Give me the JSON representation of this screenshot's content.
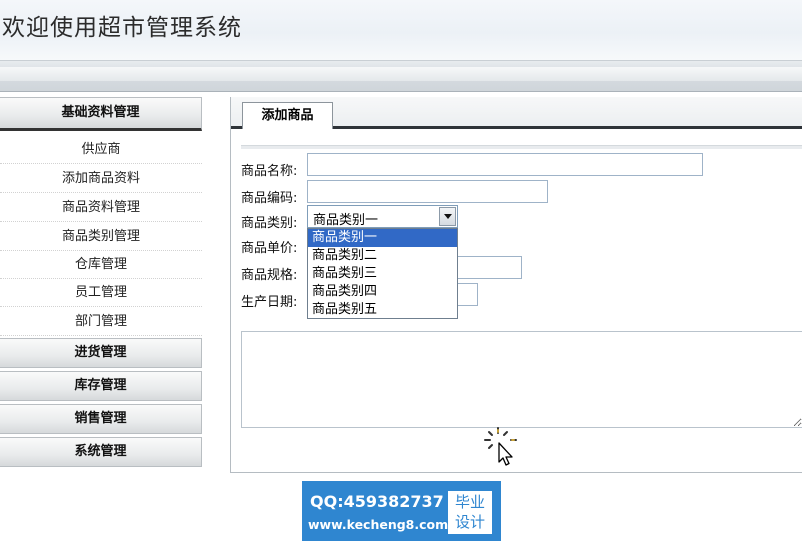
{
  "app": {
    "title": "欢迎使用超市管理系统"
  },
  "sidebar": {
    "sections": [
      {
        "label": "基础资料管理"
      },
      {
        "label": "进货管理"
      },
      {
        "label": "库存管理"
      },
      {
        "label": "销售管理"
      },
      {
        "label": "系统管理"
      }
    ],
    "items": [
      {
        "label": "供应商"
      },
      {
        "label": "添加商品资料"
      },
      {
        "label": "商品资料管理"
      },
      {
        "label": "商品类别管理"
      },
      {
        "label": "仓库管理"
      },
      {
        "label": "员工管理"
      },
      {
        "label": "部门管理"
      }
    ]
  },
  "main": {
    "tab": {
      "label": "添加商品"
    },
    "form": {
      "name_label": "商品名称:",
      "name_value": "",
      "code_label": "商品编码:",
      "code_value": "",
      "category_label": "商品类别:",
      "category_selected": "商品类别一",
      "category_options": [
        "商品类别一",
        "商品类别二",
        "商品类别三",
        "商品类别四",
        "商品类别五"
      ],
      "price_label": "商品单价:",
      "spec_label": "商品规格:",
      "spec_value": "",
      "date_label": "生产日期:",
      "date_value": "",
      "notes_value": ""
    }
  },
  "watermark": {
    "qq": "QQ:459382737",
    "site": "www.kecheng8.com",
    "badge_line1": "毕业",
    "badge_line2": "设计"
  },
  "colors": {
    "selected_option": "#3169c6",
    "watermark_bg": "#2f86d0"
  }
}
